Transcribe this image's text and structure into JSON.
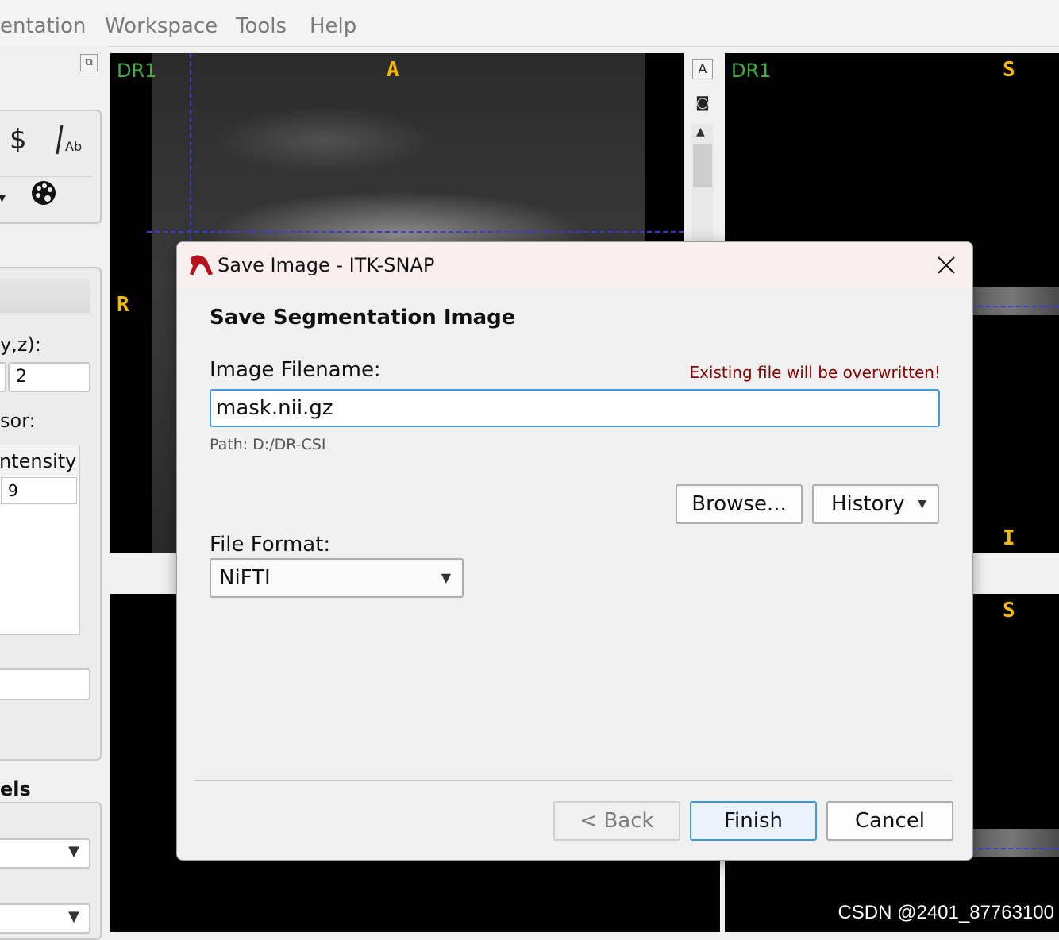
{
  "menu": {
    "items": [
      "entation",
      "Workspace",
      "Tools",
      "Help"
    ]
  },
  "left_panel": {
    "coord_label": "y,z):",
    "coord_value": "2",
    "cursor_label": "sor:",
    "intensity_header": "ntensity",
    "intensity_value": "9",
    "labels_heading": "els"
  },
  "views": {
    "top_left": {
      "layer": "DR1",
      "top": "A",
      "left": "R"
    },
    "top_right": {
      "layer": "DR1",
      "top": "S",
      "bottom": "I"
    },
    "bottom_right": {
      "top": "S"
    }
  },
  "dialog": {
    "title": "Save Image - ITK-SNAP",
    "heading": "Save Segmentation Image",
    "filename_label": "Image Filename:",
    "warning": "Existing file will be overwritten!",
    "filename_value": "mask.nii.gz",
    "path_text": "Path: D:/DR-CSI",
    "browse_label": "Browse...",
    "history_label": "History",
    "format_label": "File Format:",
    "format_value": "NiFTI",
    "back_label": "< Back",
    "finish_label": "Finish",
    "cancel_label": "Cancel"
  },
  "colors": {
    "warning": "#8b0000",
    "orientation": "#f5b800",
    "layer_label": "#3cb043",
    "crosshair": "#3b3bdc",
    "focus_border": "#3c9be0"
  },
  "watermark": "CSDN @2401_87763100"
}
